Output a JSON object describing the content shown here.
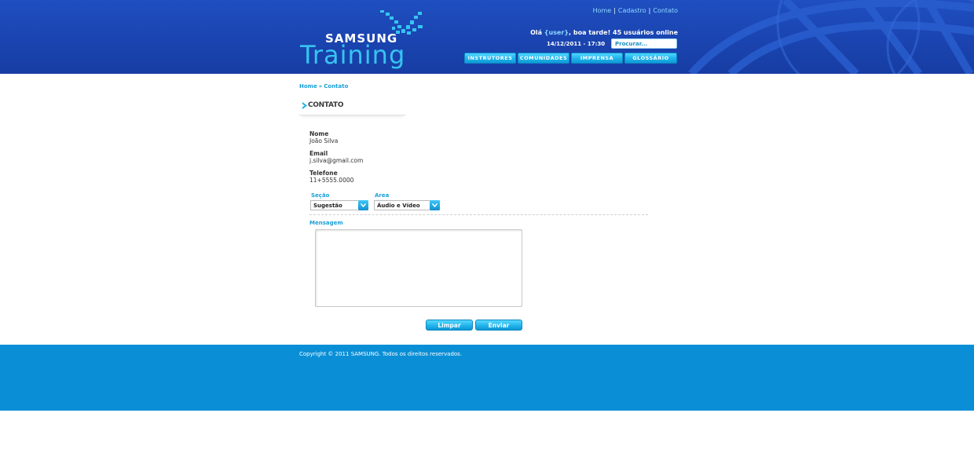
{
  "brand": {
    "samsung": "SAMSUNG",
    "training": "Training"
  },
  "toplinks": [
    "Home",
    "Cadastro",
    "Contato"
  ],
  "greeting": {
    "prefix": "Olá ",
    "user": "{user}",
    "suffix": ", boa tarde! 45 usuários online"
  },
  "datetime": "14/12/2011 - 17:30",
  "search": {
    "placeholder": "Procurar..."
  },
  "nav": [
    "INSTRUTORES",
    "COMUNIDADES",
    "IMPRENSA",
    "GLOSSÁRIO"
  ],
  "breadcrumb": {
    "home": "Home",
    "sep": "»",
    "current": "Contato"
  },
  "section_title": "CONTATO",
  "fields": [
    {
      "label": "Nome",
      "value": "João Silva"
    },
    {
      "label": "Email",
      "value": "j.silva@gmail.com"
    },
    {
      "label": "Telefone",
      "value": "11+5555.0000"
    }
  ],
  "selects": {
    "secao": {
      "label": "Seção",
      "value": "Sugestão"
    },
    "area": {
      "label": "Area",
      "value": "Áudio e Vídeo"
    }
  },
  "mensagem": {
    "label": "Mensagem",
    "value": ""
  },
  "buttons": {
    "clear": "Limpar",
    "send": "Enviar"
  },
  "footer": {
    "copyright": "Copyright © 2011 SAMSUNG. Todos os direitos reservados."
  },
  "colors": {
    "header_blue": "#1a44b0",
    "accent_cyan": "#1eb2ea",
    "link_blue": "#1a9fd8",
    "footer_blue": "#0a8fd6"
  }
}
